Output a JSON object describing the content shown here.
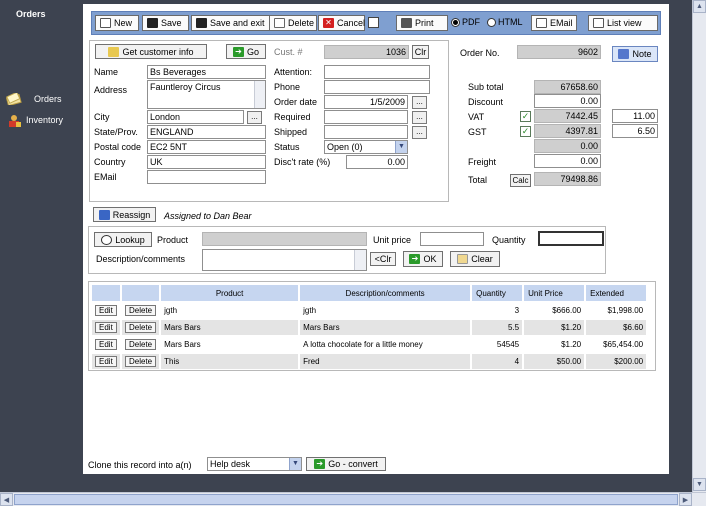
{
  "sidebar": {
    "title": "Orders",
    "items": [
      {
        "label": "Orders",
        "icon": "orders-icon"
      },
      {
        "label": "Inventory",
        "icon": "inventory-icon"
      }
    ]
  },
  "toolbar": {
    "new": "New",
    "save": "Save",
    "save_exit": "Save and exit",
    "delete": "Delete",
    "cancel": "Cancel",
    "print": "Print",
    "pdf": "PDF",
    "html": "HTML",
    "email": "EMail",
    "list_view": "List view"
  },
  "customer": {
    "get_info_label": "Get customer info",
    "go_label": "Go",
    "cust_no_label": "Cust. #",
    "cust_no_value": "1036",
    "clr_label": "Clr",
    "name_label": "Name",
    "name_value": "Bs Beverages",
    "address_label": "Address",
    "address_value": "Fauntleroy Circus",
    "city_label": "City",
    "city_value": "London",
    "state_label": "State/Prov.",
    "state_value": "ENGLAND",
    "postal_label": "Postal code",
    "postal_value": "EC2 5NT",
    "country_label": "Country",
    "country_value": "UK",
    "email_label": "EMail",
    "email_value": ""
  },
  "details": {
    "attention_label": "Attention:",
    "phone_label": "Phone",
    "order_date_label": "Order date",
    "order_date_value": "1/5/2009",
    "required_label": "Required",
    "shipped_label": "Shipped",
    "status_label": "Status",
    "status_value": "Open (0)",
    "disc_rate_label": "Disc't rate (%)",
    "disc_rate_value": "0.00"
  },
  "totals": {
    "order_no_label": "Order No.",
    "order_no_value": "9602",
    "note_label": "Note",
    "subtotal_label": "Sub total",
    "subtotal_value": "67658.60",
    "discount_label": "Discount",
    "discount_value": "0.00",
    "vat_label": "VAT",
    "vat_value": "7442.45",
    "vat_rate": "11.00",
    "gst_label": "GST",
    "gst_value": "4397.81",
    "gst_rate": "6.50",
    "blank_value": "0.00",
    "freight_label": "Freight",
    "freight_value": "0.00",
    "total_label": "Total",
    "calc_label": "Calc",
    "total_value": "79498.86"
  },
  "assign": {
    "reassign_label": "Reassign",
    "assigned_text": "Assigned to Dan Bear"
  },
  "lineentry": {
    "lookup_label": "Lookup",
    "product_label": "Product",
    "unit_price_label": "Unit price",
    "quantity_label": "Quantity",
    "desc_label": "Description/comments",
    "clr_label": "<Clr",
    "ok_label": "OK",
    "clear_label": "Clear"
  },
  "table": {
    "headers": [
      "",
      "",
      "Product",
      "Description/comments",
      "Quantity",
      "Unit Price",
      "Extended"
    ],
    "edit_label": "Edit",
    "delete_label": "Delete",
    "rows": [
      {
        "product": "jgth",
        "desc": "jgth",
        "qty": "3",
        "price": "$666.00",
        "ext": "$1,998.00"
      },
      {
        "product": "Mars Bars",
        "desc": "Mars Bars",
        "qty": "5.5",
        "price": "$1.20",
        "ext": "$6.60"
      },
      {
        "product": "Mars Bars",
        "desc": "A lotta chocolate for a little money",
        "qty": "54545",
        "price": "$1.20",
        "ext": "$65,454.00"
      },
      {
        "product": "This",
        "desc": "Fred",
        "qty": "4",
        "price": "$50.00",
        "ext": "$200.00"
      }
    ]
  },
  "clone": {
    "label": "Clone this record into a(n)",
    "select_value": "Help desk",
    "go_label": "Go - convert"
  }
}
